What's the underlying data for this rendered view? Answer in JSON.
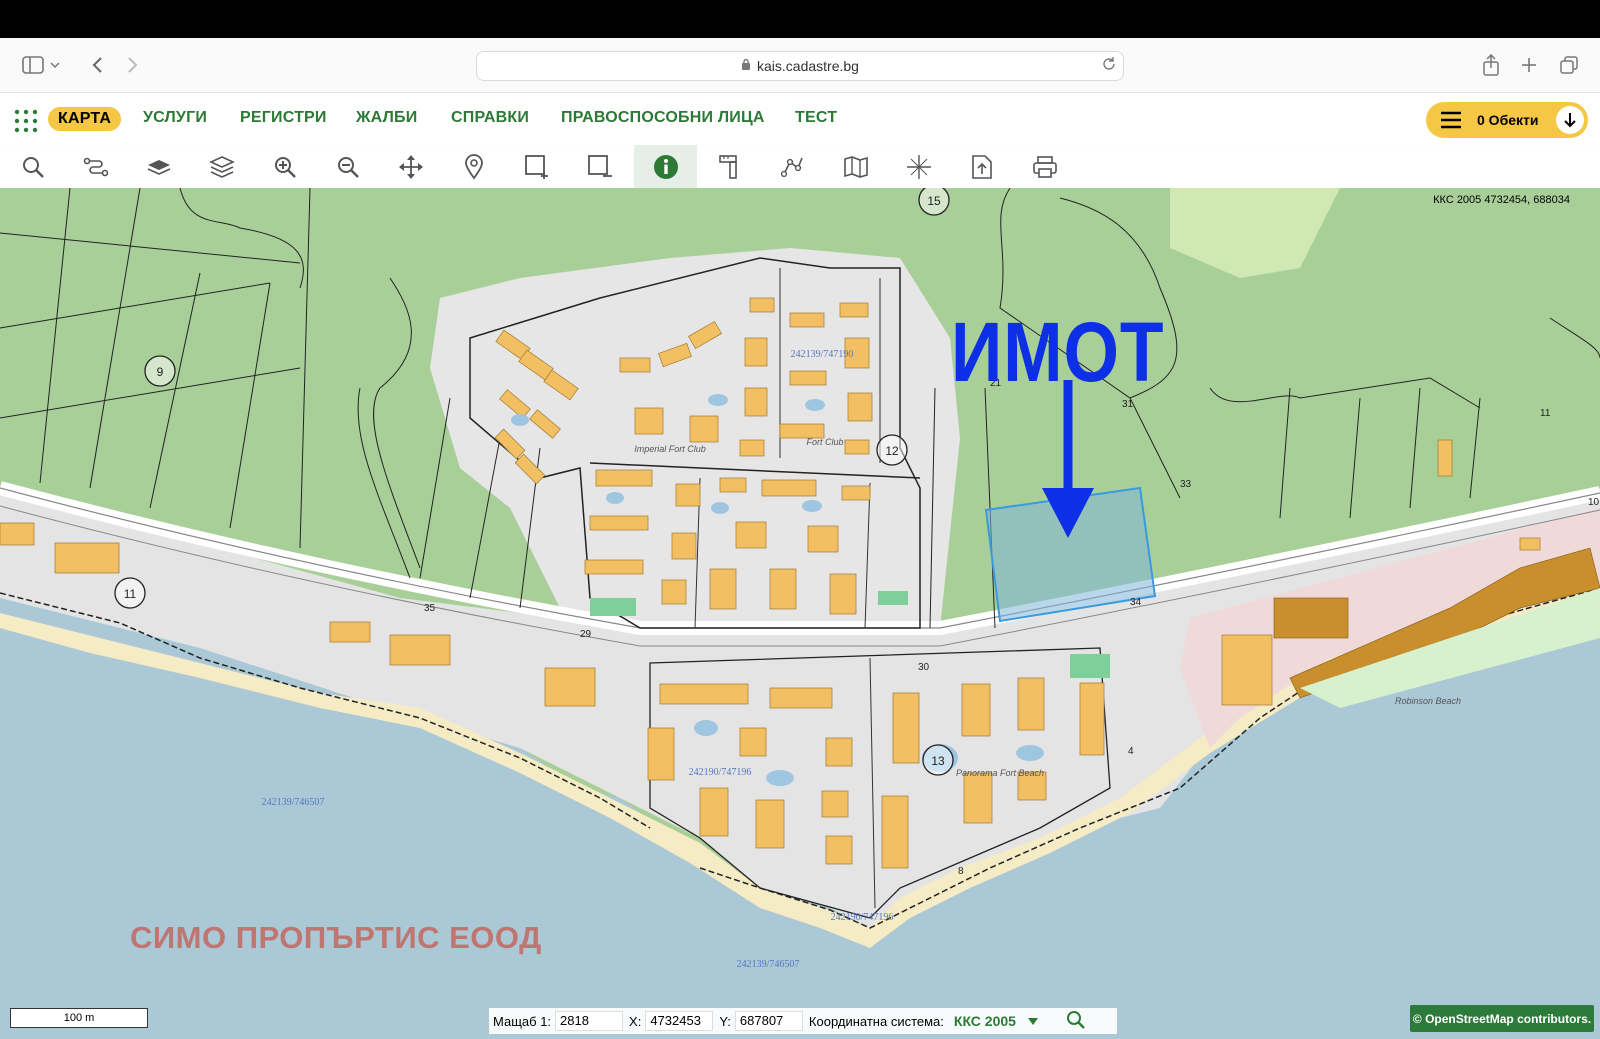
{
  "browser": {
    "url": "kais.cadastre.bg"
  },
  "nav": {
    "items": [
      {
        "label": "КАРТА",
        "active": true
      },
      {
        "label": "УСЛУГИ"
      },
      {
        "label": "РЕГИСТРИ"
      },
      {
        "label": "ЖАЛБИ"
      },
      {
        "label": "СПРАВКИ"
      },
      {
        "label": "ПРАВОСПОСОБНИ ЛИЦА"
      },
      {
        "label": "ТЕСТ"
      }
    ],
    "basket_label": "0 Обекти"
  },
  "toolbar": {
    "tools": [
      "search-icon",
      "route-icon",
      "layer-single-icon",
      "layers-icon",
      "zoom-in-icon",
      "zoom-out-icon",
      "pan-icon",
      "marker-icon",
      "select-add-icon",
      "select-remove-icon",
      "info-icon",
      "measure-icon",
      "polyline-icon",
      "map-icon",
      "crosshair-icon",
      "export-icon",
      "print-icon"
    ],
    "active_tool": "info-icon"
  },
  "map": {
    "coord_readout": "ККС 2005 4732454, 688034",
    "annotation": "ИМОТ",
    "owner_label": "СИМО ПРОПЪРТИС ЕООД",
    "region_numbers": [
      "15",
      "9",
      "12",
      "11",
      "13"
    ],
    "parcel_labels": [
      "242139/747190",
      "242190/747196",
      "242139/746507",
      "242139/746507",
      "242190/747196",
      "Imperial Fort Club",
      "Fort Club",
      "Panorama Fort Beach",
      "Robinson Beach"
    ],
    "point_labels": [
      "21",
      "31",
      "33",
      "34",
      "35",
      "29",
      "30",
      "4",
      "8",
      "10",
      "11"
    ],
    "colors": {
      "forest": "#a9cf98",
      "urban": "#e4e4e4",
      "building": "#f2c062",
      "sea": "#aac8d6",
      "beach": "#f5ebc4",
      "arrow": "#0d2fe6",
      "parcel_highlight": "#7fb6d9"
    }
  },
  "status": {
    "scale_label": "Мащаб 1:",
    "scale_value": "2818",
    "x_label": "X:",
    "x_value": "4732453",
    "y_label": "Y:",
    "y_value": "687807",
    "crs_label": "Координатна система:",
    "crs_value": "ККС 2005",
    "scalebar": "100 m",
    "attribution": "© OpenStreetMap contributors."
  }
}
